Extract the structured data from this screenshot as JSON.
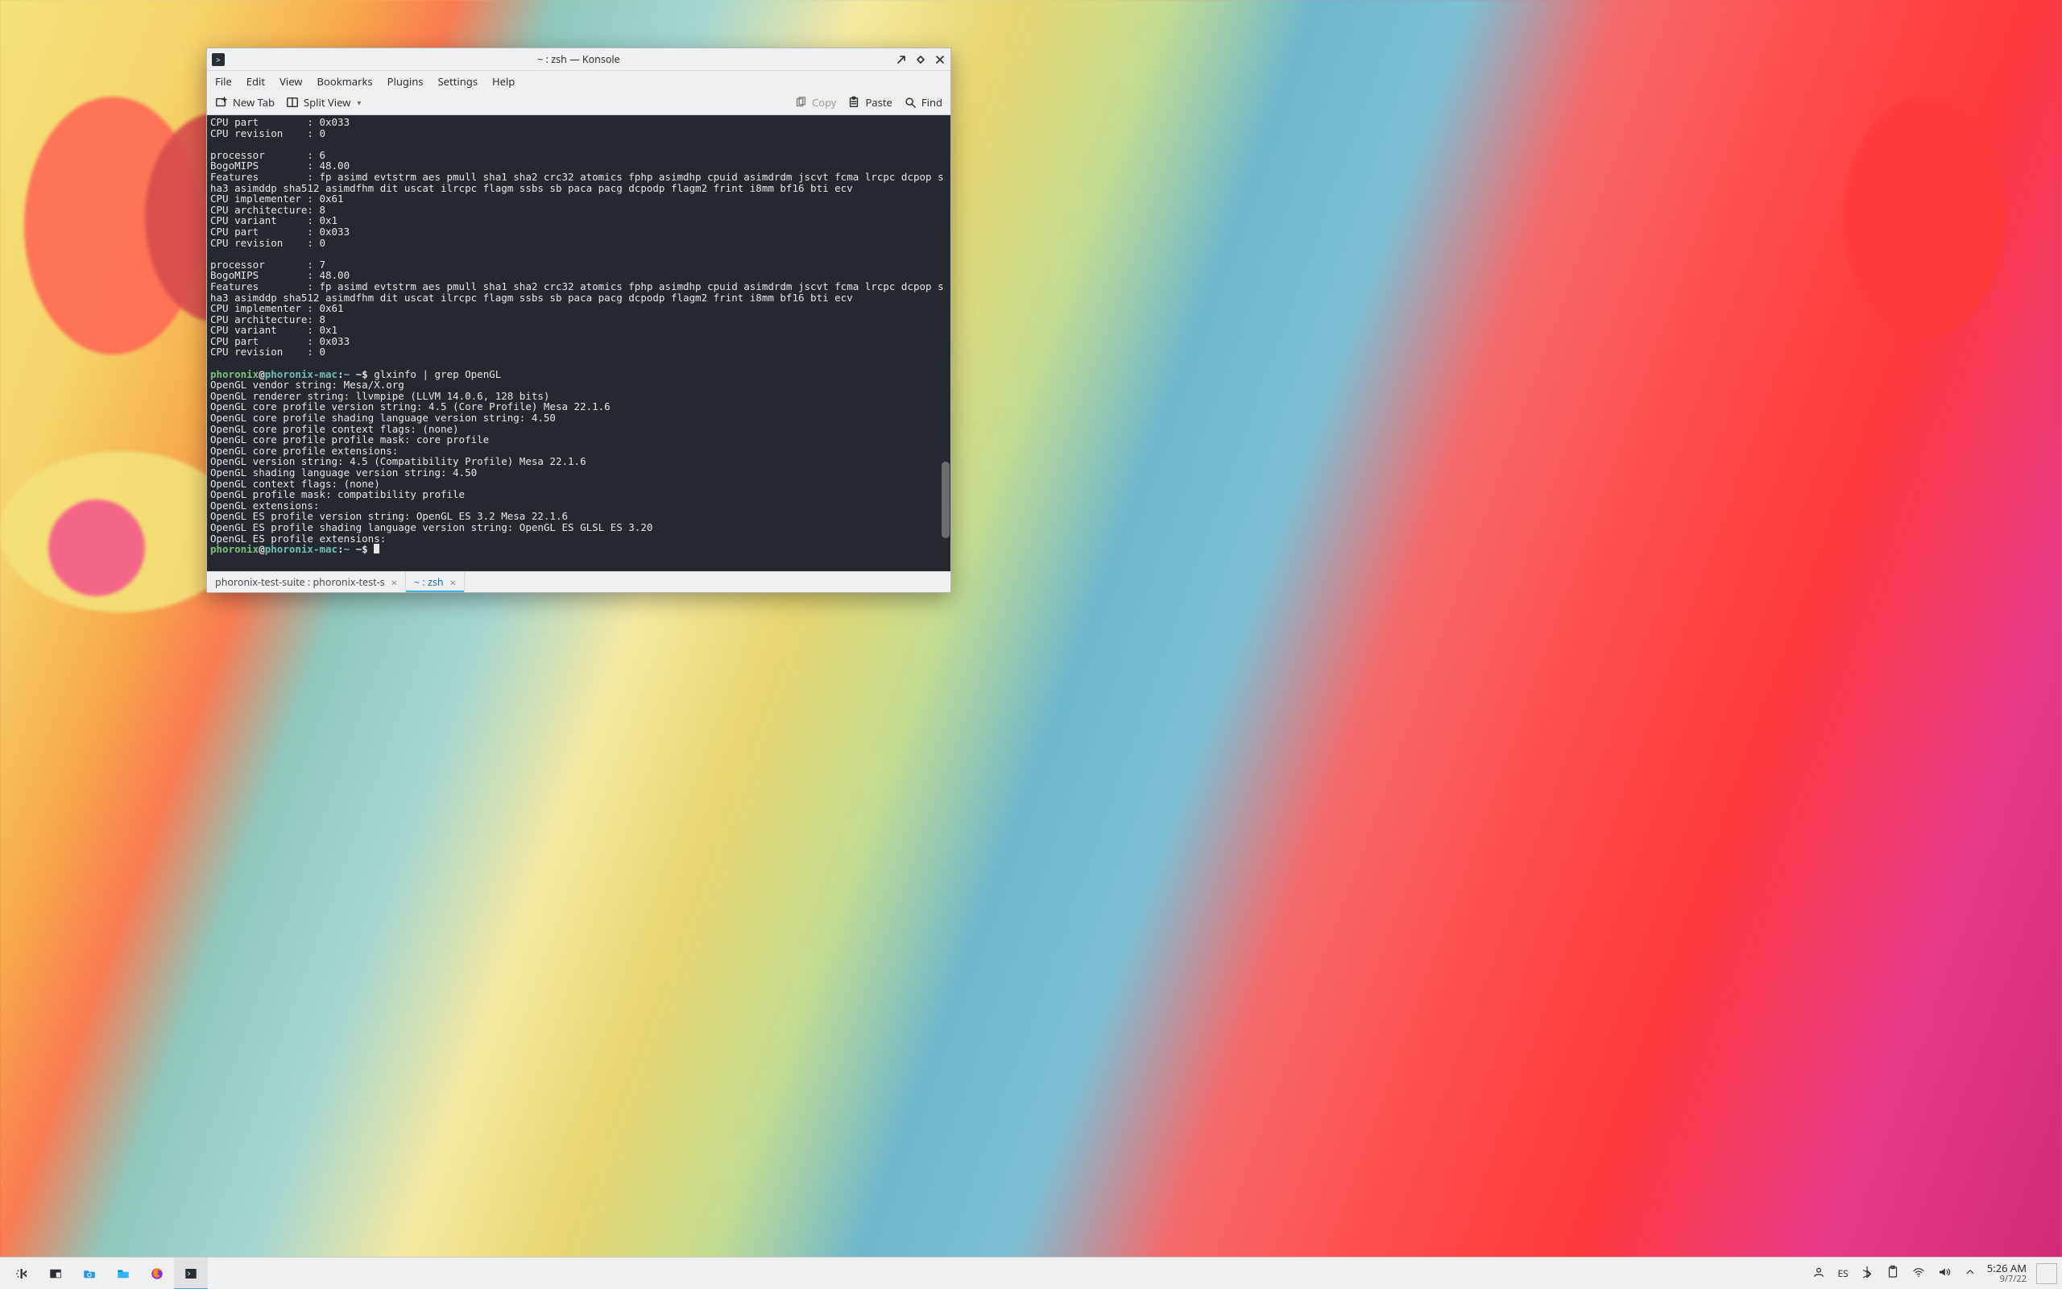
{
  "window": {
    "title": "~ : zsh — Konsole",
    "menubar": [
      "File",
      "Edit",
      "View",
      "Bookmarks",
      "Plugins",
      "Settings",
      "Help"
    ],
    "toolbar": {
      "new_tab": "New Tab",
      "split_view": "Split View",
      "copy": "Copy",
      "paste": "Paste",
      "find": "Find"
    },
    "tabs": [
      {
        "label": "phoronix-test-suite : phoronix-test-s",
        "active": false
      },
      {
        "label": "~ : zsh",
        "active": true
      }
    ]
  },
  "terminal": {
    "top_block": "CPU part        : 0x033\nCPU revision    : 0\n\nprocessor       : 6\nBogoMIPS        : 48.00\nFeatures        : fp asimd evtstrm aes pmull sha1 sha2 crc32 atomics fphp asimdhp cpuid asimdrdm jscvt fcma lrcpc dcpop sha3 asimddp sha512 asimdfhm dit uscat ilrcpc flagm ssbs sb paca pacg dcpodp flagm2 frint i8mm bf16 bti ecv\nCPU implementer : 0x61\nCPU architecture: 8\nCPU variant     : 0x1\nCPU part        : 0x033\nCPU revision    : 0\n\nprocessor       : 7\nBogoMIPS        : 48.00\nFeatures        : fp asimd evtstrm aes pmull sha1 sha2 crc32 atomics fphp asimdhp cpuid asimdrdm jscvt fcma lrcpc dcpop sha3 asimddp sha512 asimdfhm dit uscat ilrcpc flagm ssbs sb paca pacg dcpodp flagm2 frint i8mm bf16 bti ecv\nCPU implementer : 0x61\nCPU architecture: 8\nCPU variant     : 0x1\nCPU part        : 0x033\nCPU revision    : 0\n",
    "prompt": {
      "user": "phoronix",
      "at": "@",
      "host": "phoronix-mac",
      "sep": ":",
      "path": "~",
      "sigil": " ~$ "
    },
    "cmd1": "glxinfo | grep OpenGL",
    "glx_output": "OpenGL vendor string: Mesa/X.org\nOpenGL renderer string: llvmpipe (LLVM 14.0.6, 128 bits)\nOpenGL core profile version string: 4.5 (Core Profile) Mesa 22.1.6\nOpenGL core profile shading language version string: 4.50\nOpenGL core profile context flags: (none)\nOpenGL core profile profile mask: core profile\nOpenGL core profile extensions:\nOpenGL version string: 4.5 (Compatibility Profile) Mesa 22.1.6\nOpenGL shading language version string: 4.50\nOpenGL context flags: (none)\nOpenGL profile mask: compatibility profile\nOpenGL extensions:\nOpenGL ES profile version string: OpenGL ES 3.2 Mesa 22.1.6\nOpenGL ES profile shading language version string: OpenGL ES GLSL ES 3.20\nOpenGL ES profile extensions:"
  },
  "taskbar": {
    "clock": {
      "time": "5:26 AM",
      "date": "9/7/22"
    },
    "input_method": "ES"
  }
}
